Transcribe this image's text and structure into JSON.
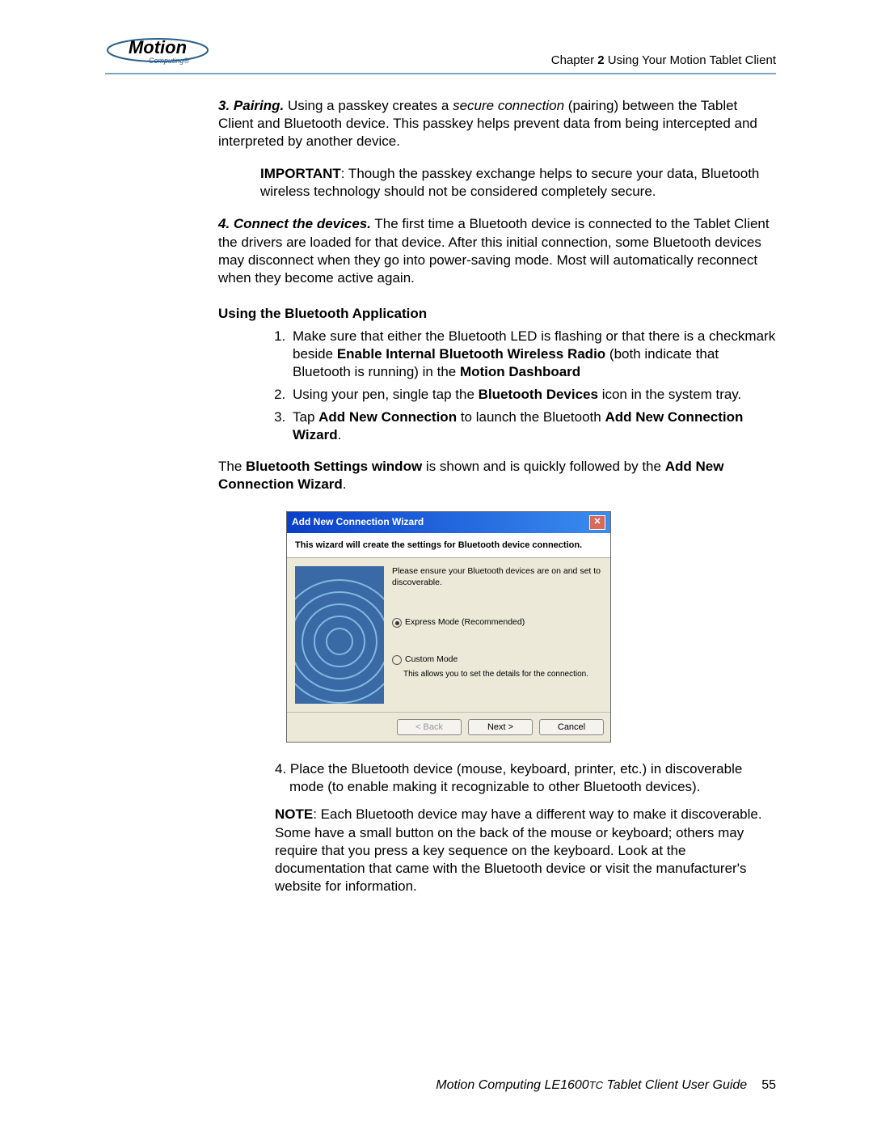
{
  "header": {
    "logo_text": "Motion",
    "logo_sub": "Computing",
    "chapter_prefix": "Chapter ",
    "chapter_num": "2",
    "chapter_title": "  Using Your Motion Tablet Client"
  },
  "section3": {
    "num": "3. Pairing.",
    "text_a": " Using a passkey creates a ",
    "italic": "secure connection",
    "text_b": " (pairing) between the Tablet Client and Bluetooth device. This passkey helps prevent data from being intercepted and interpreted by another device."
  },
  "important": {
    "label": "IMPORTANT",
    "text": ": Though the passkey exchange helps to secure your data, Bluetooth wireless technology should not be considered completely secure."
  },
  "section4": {
    "num": "4. Connect the devices.",
    "text": " The first time a Bluetooth device is connected to the Tablet Client the drivers are loaded for that device. After this initial connection, some Bluetooth devices may disconnect when they go into power-saving mode. Most will automatically reconnect when they become active again."
  },
  "heading": "Using the Bluetooth Application",
  "steps": {
    "s1_a": "Make sure that either the Bluetooth LED is flashing or that there is a checkmark beside ",
    "s1_b": "Enable Internal Bluetooth Wireless Radio",
    "s1_c": " (both indicate that Bluetooth is running) in the ",
    "s1_d": "Motion Dashboard",
    "s2_a": "Using your pen, single tap the ",
    "s2_b": "Bluetooth Devices",
    "s2_c": " icon in the system tray.",
    "s3_a": "Tap ",
    "s3_b": "Add New Connection",
    "s3_c": " to launch the Bluetooth ",
    "s3_d": "Add New Connection Wizard",
    "s3_e": "."
  },
  "after_steps": {
    "a": "The ",
    "b": "Bluetooth Settings window",
    "c": " is shown and is quickly followed by the ",
    "d": "Add New Connection Wizard",
    "e": "."
  },
  "wizard": {
    "title": "Add New Connection Wizard",
    "subhead": "This wizard will create the settings for Bluetooth device connection.",
    "instruction": "Please ensure your Bluetooth devices are on and set to discoverable.",
    "opt1": "Express Mode (Recommended)",
    "opt2": "Custom Mode",
    "opt2_note": "This allows you to set the details for the connection.",
    "back": "< Back",
    "next": "Next >",
    "cancel": "Cancel"
  },
  "step4": {
    "num": "4. ",
    "text": "Place the Bluetooth device (mouse, keyboard, printer, etc.) in discoverable mode (to enable making it recognizable to other Bluetooth devices)."
  },
  "note": {
    "label": "NOTE",
    "text": ": Each Bluetooth device may have a different way to make it discoverable. Some have a small button on the back of the mouse or keyboard; others may require that you press a key sequence on the keyboard. Look at the documentation that came with the Bluetooth device or visit the manufacturer's website for information."
  },
  "footer": {
    "prefix": "Motion Computing LE1600",
    "model": "TC",
    "suffix": " Tablet Client User Guide",
    "page": "55"
  }
}
